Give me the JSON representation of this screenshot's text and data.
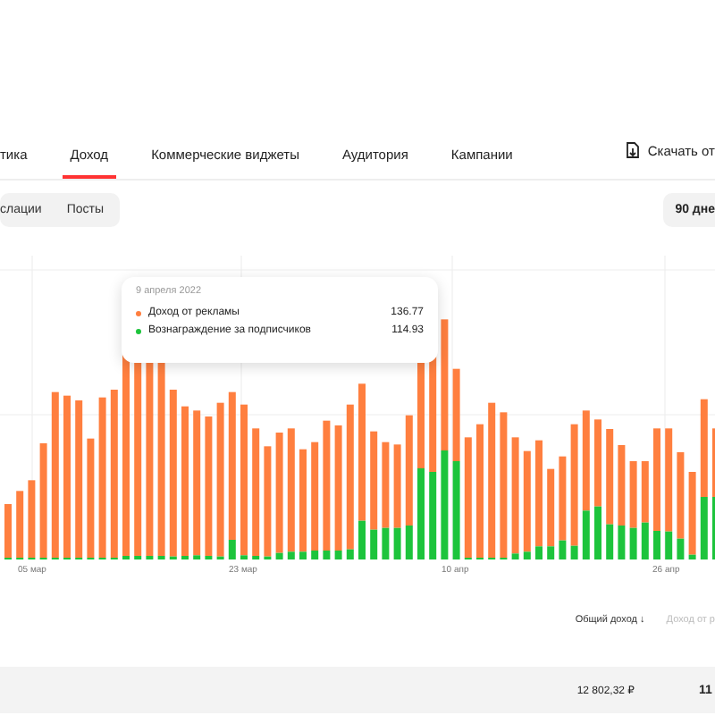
{
  "tabs": [
    {
      "label": "тика",
      "selected": false
    },
    {
      "label": "Доход",
      "selected": true
    },
    {
      "label": "Коммерческие виджеты",
      "selected": false
    },
    {
      "label": "Аудитория",
      "selected": false
    },
    {
      "label": "Кампании",
      "selected": false
    }
  ],
  "download": {
    "label": "Скачать от"
  },
  "filters": [
    {
      "label": "слации",
      "selected": false
    },
    {
      "label": "Посты",
      "selected": false
    }
  ],
  "period": {
    "label": "90 дне"
  },
  "tooltip": {
    "date": "9 апреля 2022",
    "rows": [
      {
        "label": "Доход от рекламы",
        "value": "136.77",
        "color": "#ff7f3f"
      },
      {
        "label": "Вознаграждение за подписчиков",
        "value": "114.93",
        "color": "#1dc43c"
      }
    ]
  },
  "x_axis_labels": [
    "05 мар",
    "23 мар",
    "10 апр",
    "26 апр"
  ],
  "sort_headers": [
    {
      "label": "Общий доход ↓",
      "selected": true
    },
    {
      "label": "Доход от р",
      "selected": false
    }
  ],
  "total_row": {
    "cells": [
      "12 802,32 ₽",
      "11"
    ]
  }
}
